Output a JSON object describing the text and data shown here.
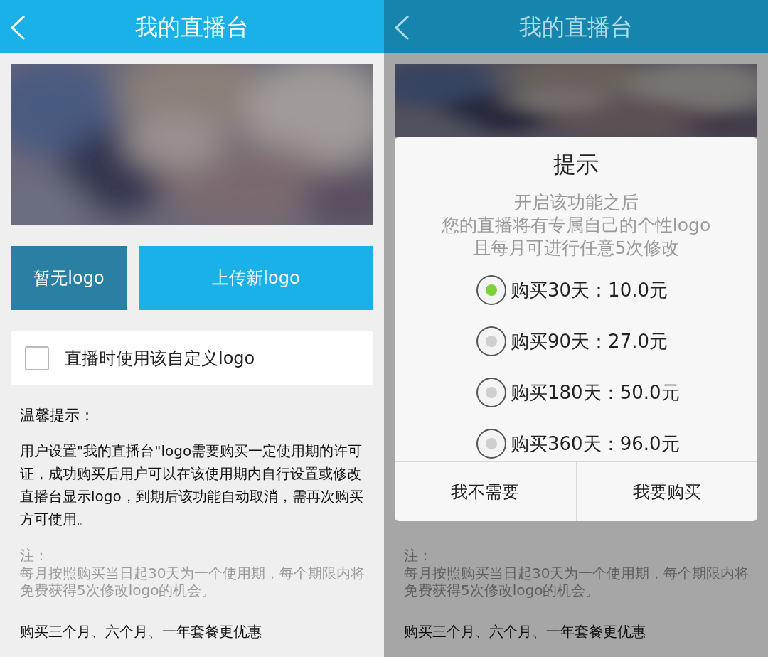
{
  "screens": [
    {
      "dimmed": false,
      "header": {
        "title": "我的直播台"
      },
      "banner": {
        "kind": "picture"
      },
      "logo_buttons": [
        {
          "label": "暂无logo",
          "selected": true
        },
        {
          "label": "上传新logo",
          "selected": false
        }
      ],
      "checkbox": {
        "label": "直播时使用该自定义logo",
        "checked": false
      },
      "tips": {
        "heading": "温馨提示：",
        "body": "用户设置\"我的直播台\"logo需要购买一定使用期的许可证，成功购买后用户可以在该使用期内自行设置或修改直播台显示logo，到期后该功能自动取消，需再次购买方可使用。",
        "note_heading": "注：",
        "note": "每月按照购买当日起30天为一个使用期，每个期限内将免费获得5次修改logo的机会。",
        "promo": "购买三个月、六个月、一年套餐更优惠"
      }
    },
    {
      "dimmed": true,
      "header": {
        "title": "我的直播台"
      },
      "banner": {
        "kind": "picture"
      },
      "tips": {
        "note_heading": "注：",
        "note": "每月按照购买当日起30天为一个使用期，每个期限内将免费获得5次修改logo的机会。",
        "promo": "购买三个月、六个月、一年套餐更优惠"
      }
    }
  ],
  "dialog": {
    "title": "提示",
    "message_lines": [
      "开启该功能之后",
      "您的直播将有专属自己的个性logo",
      "且每月可进行任意5次修改"
    ],
    "options": [
      {
        "label": "购买30天：10.0元",
        "selected": true
      },
      {
        "label": "购买90天：27.0元",
        "selected": false
      },
      {
        "label": "购买180天：50.0元",
        "selected": false
      },
      {
        "label": "购买360天：96.0元",
        "selected": false
      }
    ],
    "buttons": [
      "我不需要",
      "我要购买"
    ]
  }
}
